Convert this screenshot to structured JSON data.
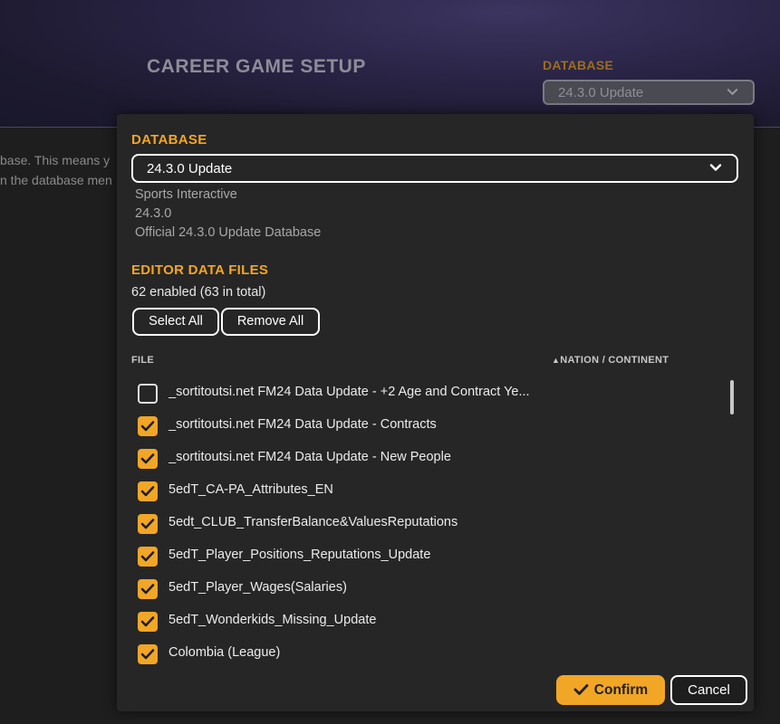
{
  "background": {
    "title": "CAREER GAME SETUP",
    "database_label": "DATABASE",
    "database_value": "24.3.0 Update",
    "description_line1": "base. This means y",
    "description_line2": "n the database men"
  },
  "dialog": {
    "database_label": "DATABASE",
    "database_value": "24.3.0 Update",
    "database_info": {
      "author": "Sports Interactive",
      "version": "24.3.0",
      "description": "Official 24.3.0 Update Database"
    },
    "editor_files_label": "EDITOR DATA FILES",
    "enabled_count": "62 enabled (63 in total)",
    "select_all_label": "Select All",
    "remove_all_label": "Remove All",
    "columns": {
      "file": "FILE",
      "nation": "NATION / CONTINENT"
    },
    "files": [
      {
        "name": "_sortitoutsi.net FM24 Data Update - +2 Age and Contract Ye...",
        "checked": false
      },
      {
        "name": "_sortitoutsi.net FM24 Data Update - Contracts",
        "checked": true
      },
      {
        "name": "_sortitoutsi.net FM24 Data Update - New People",
        "checked": true
      },
      {
        "name": "5edT_CA-PA_Attributes_EN",
        "checked": true
      },
      {
        "name": "5edt_CLUB_TransferBalance&ValuesReputations",
        "checked": true
      },
      {
        "name": "5edT_Player_Positions_Reputations_Update",
        "checked": true
      },
      {
        "name": "5edT_Player_Wages(Salaries)",
        "checked": true
      },
      {
        "name": "5edT_Wonderkids_Missing_Update",
        "checked": true
      },
      {
        "name": "Colombia (League)",
        "checked": true
      }
    ],
    "confirm_label": "Confirm",
    "cancel_label": "Cancel"
  },
  "colors": {
    "accent": "#f2a626",
    "modal_bg": "#262626",
    "page_bg": "#1e1e1e"
  }
}
